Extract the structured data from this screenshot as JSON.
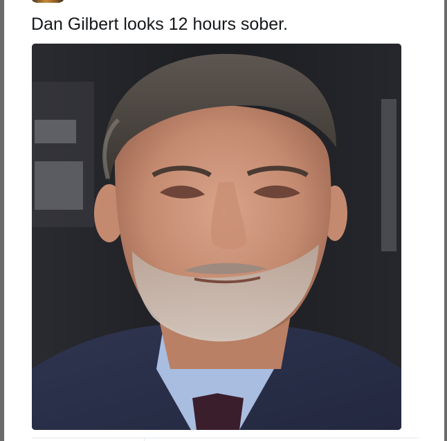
{
  "tweet": {
    "text": "Dan Gilbert looks 12 hours sober."
  },
  "photo": {
    "subject": "press-conference-portrait"
  },
  "colors": {
    "text": "#14171a",
    "rail": "#6b6b6b",
    "divider": "#e1e8ed"
  }
}
